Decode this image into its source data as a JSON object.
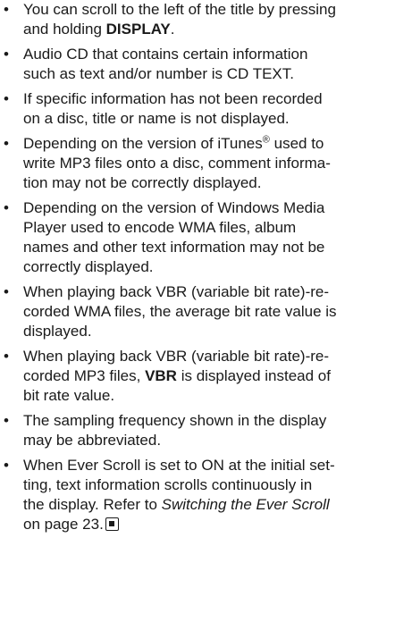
{
  "bullet_glyph": "•",
  "items": [
    {
      "a": "You can scroll to the left of the title by pressing",
      "b": "and holding ",
      "bold": "DISPLAY",
      "c": "."
    },
    {
      "a": "Audio CD that contains certain information",
      "b": "such as text and/or number is CD TEXT."
    },
    {
      "a": "If specific information has not been recorded",
      "b": "on a disc, title or name is not displayed."
    },
    {
      "a": "Depending on the version of iTunes",
      "reg": "®",
      "b": " used to",
      "c": "write MP3 files onto a disc, comment informa-",
      "d": "tion may not be correctly displayed."
    },
    {
      "a": "Depending on the version of Windows Media",
      "b": "Player used to encode WMA files, album",
      "c": "names and other text information may not be",
      "d": "correctly displayed."
    },
    {
      "a": "When playing back VBR (variable bit rate)-re-",
      "b": "corded WMA files, the average bit rate value is",
      "c": "displayed."
    },
    {
      "a": "When playing back VBR (variable bit rate)-re-",
      "b": "corded MP3 files, ",
      "bold": "VBR",
      "c": " is displayed instead of",
      "d": "bit rate value."
    },
    {
      "a": "The sampling frequency shown in the display",
      "b": "may be abbreviated."
    },
    {
      "a": "When Ever Scroll is set to ON at the initial set-",
      "b": "ting, text information scrolls continuously in",
      "c": "the display. Refer to ",
      "italic": "Switching the Ever Scroll",
      "d": "on page 23.",
      "end_icon": "section-end-icon"
    }
  ]
}
